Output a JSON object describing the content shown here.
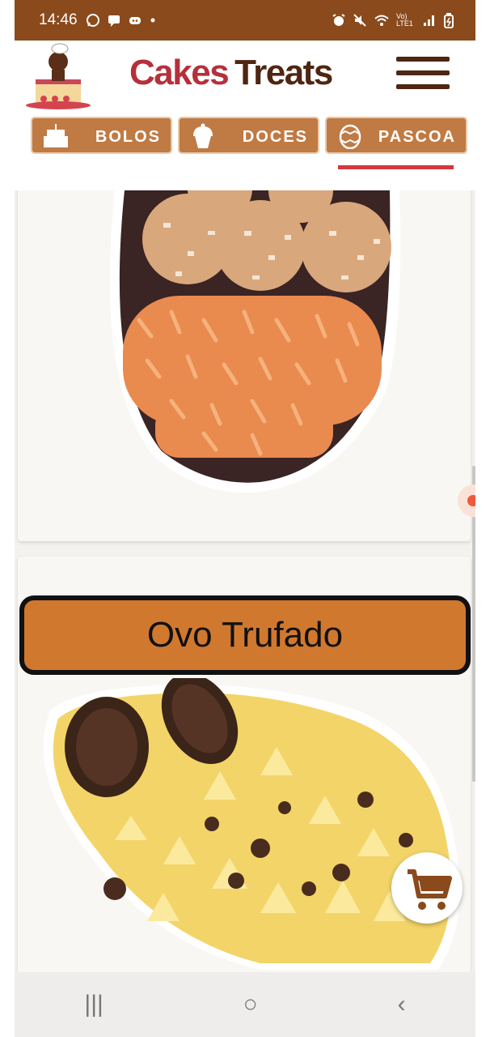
{
  "status_bar": {
    "time": "14:46",
    "icons": [
      "whatsapp-icon",
      "chat-icon",
      "discord-icon",
      "dot-icon"
    ],
    "right_icons": [
      "alarm-icon",
      "mute-icon",
      "wifi-icon",
      "volte-icon",
      "signal-icon",
      "battery-icon"
    ],
    "volte_label": "Vo) LTE1"
  },
  "header": {
    "brand_part1": "Cakes",
    "brand_part2": "Treats",
    "colors": {
      "brand_red": "#b5303a",
      "brand_brown": "#4e2612"
    }
  },
  "tabs": [
    {
      "label": "BOLOS",
      "icon": "cake-icon",
      "selected": false
    },
    {
      "label": "DOCES",
      "icon": "cupcake-icon",
      "selected": false
    },
    {
      "label": "PASCOA",
      "icon": "easter-egg-icon",
      "selected": true
    }
  ],
  "products": [
    {
      "title": "",
      "image": "chocolate-egg-with-truffles"
    },
    {
      "title": "Ovo Trufado",
      "image": "chocolate-egg-with-cookies-and-cream"
    }
  ],
  "floating": {
    "cart_icon": "shopping-cart-icon"
  },
  "nav_bar": {
    "recent": "|||",
    "home": "○",
    "back": "‹"
  },
  "colors": {
    "status_bar": "#8a4a1c",
    "tab_bg": "#c07a43",
    "tab_underline": "#d5383c",
    "title_bar": "#d1782f"
  }
}
